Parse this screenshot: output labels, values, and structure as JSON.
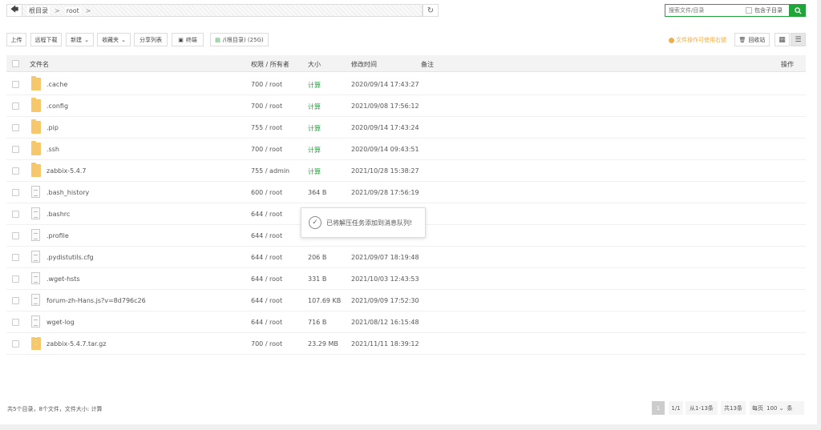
{
  "path": {
    "back_icon": "arrow-left-icon",
    "crumbs": [
      "根目录",
      "root"
    ],
    "separator": ">",
    "refresh_icon": "refresh-icon"
  },
  "search": {
    "placeholder": "搜索文件/目录",
    "sub_label": "包含子目录",
    "button_icon": "search-icon"
  },
  "toolbar": {
    "upload": "上传",
    "remote_download": "远程下载",
    "new": "新建",
    "favorites": "收藏夹",
    "share_list": "分享列表",
    "terminal": "终端",
    "disk": "/(根目录) (25G)",
    "tip": "文件操作可使用右键",
    "recycle": "回收站"
  },
  "table": {
    "headers": {
      "name": "文件名",
      "perm": "权限 / 所有者",
      "size": "大小",
      "mtime": "修改时间",
      "remark": "备注",
      "ops": "操作"
    },
    "rows": [
      {
        "name": ".cache",
        "type": "folder",
        "perm": "700 / root",
        "size": "计算",
        "mtime": "2020/09/14 17:43:27"
      },
      {
        "name": ".config",
        "type": "folder",
        "perm": "700 / root",
        "size": "计算",
        "mtime": "2021/09/08 17:56:12"
      },
      {
        "name": ".pip",
        "type": "folder",
        "perm": "755 / root",
        "size": "计算",
        "mtime": "2020/09/14 17:43:24"
      },
      {
        "name": ".ssh",
        "type": "folder",
        "perm": "700 / root",
        "size": "计算",
        "mtime": "2020/09/14 09:43:51"
      },
      {
        "name": "zabbix-5.4.7",
        "type": "folder",
        "perm": "755 / admin",
        "size": "计算",
        "mtime": "2021/10/28 15:38:27"
      },
      {
        "name": ".bash_history",
        "type": "file",
        "perm": "600 / root",
        "size": "364 B",
        "mtime": "2021/09/28 17:56:19"
      },
      {
        "name": ".bashrc",
        "type": "file",
        "perm": "644 / root",
        "size": "",
        "mtime": ""
      },
      {
        "name": ".profile",
        "type": "file",
        "perm": "644 / root",
        "size": "",
        "mtime": ""
      },
      {
        "name": ".pydistutils.cfg",
        "type": "file",
        "perm": "644 / root",
        "size": "206 B",
        "mtime": "2021/09/07 18:19:48"
      },
      {
        "name": ".wget-hsts",
        "type": "file",
        "perm": "644 / root",
        "size": "331 B",
        "mtime": "2021/10/03 12:43:53"
      },
      {
        "name": "forum-zh-Hans.js?v=8d796c26",
        "type": "file",
        "perm": "644 / root",
        "size": "107.69 KB",
        "mtime": "2021/09/09 17:52:30"
      },
      {
        "name": "wget-log",
        "type": "file",
        "perm": "644 / root",
        "size": "716 B",
        "mtime": "2021/08/12 16:15:48"
      },
      {
        "name": "zabbix-5.4.7.tar.gz",
        "type": "zip",
        "perm": "700 / root",
        "size": "23.29 MB",
        "mtime": "2021/11/11 18:39:12"
      }
    ]
  },
  "toast": {
    "message": "已将解压任务添加到消息队列!",
    "icon": "check-circle-icon"
  },
  "footer": {
    "summary": "共5个目录，8个文件，文件大小: 计算",
    "page_current": "1",
    "page_ratio": "1/1",
    "range": "从1-13条",
    "total": "共13条",
    "per_page_label": "每页",
    "per_page_value": "100",
    "unit": "条"
  }
}
